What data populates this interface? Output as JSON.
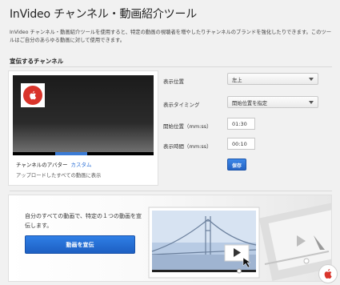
{
  "header": {
    "title": "InVideo チャンネル・動画紹介ツール",
    "intro": "InVideo チャンネル・動画紹介ツールを使用すると、特定の動画の視聴者を増やしたりチャンネルのブランドを強化したりできます。このツールはご自分のあらゆる動画に対して使用できます。"
  },
  "channel_section": {
    "title": "宣伝するチャンネル",
    "card": {
      "label": "チャンネルのアバター",
      "link": "カスタム",
      "sub": "アップロードしたすべての動画に表示",
      "progress": 0.53
    },
    "form": {
      "position_label": "表示位置",
      "position_value": "左上",
      "timing_label": "表示タイミング",
      "timing_value": "開始位置を指定",
      "start_label": "開始位置（mm:ss）",
      "start_value": "01:30",
      "duration_label": "表示時間（mm:ss）",
      "duration_value": "00:10",
      "save_label": "保存"
    }
  },
  "video_promo": {
    "text": "自分のすべての動画で、特定の１つの動画を宣伝します。",
    "button_label": "動画を宣伝"
  },
  "colors": {
    "accent": "#2a6fd6",
    "button": "#2463c4",
    "avatar_red": "#d9342b"
  }
}
